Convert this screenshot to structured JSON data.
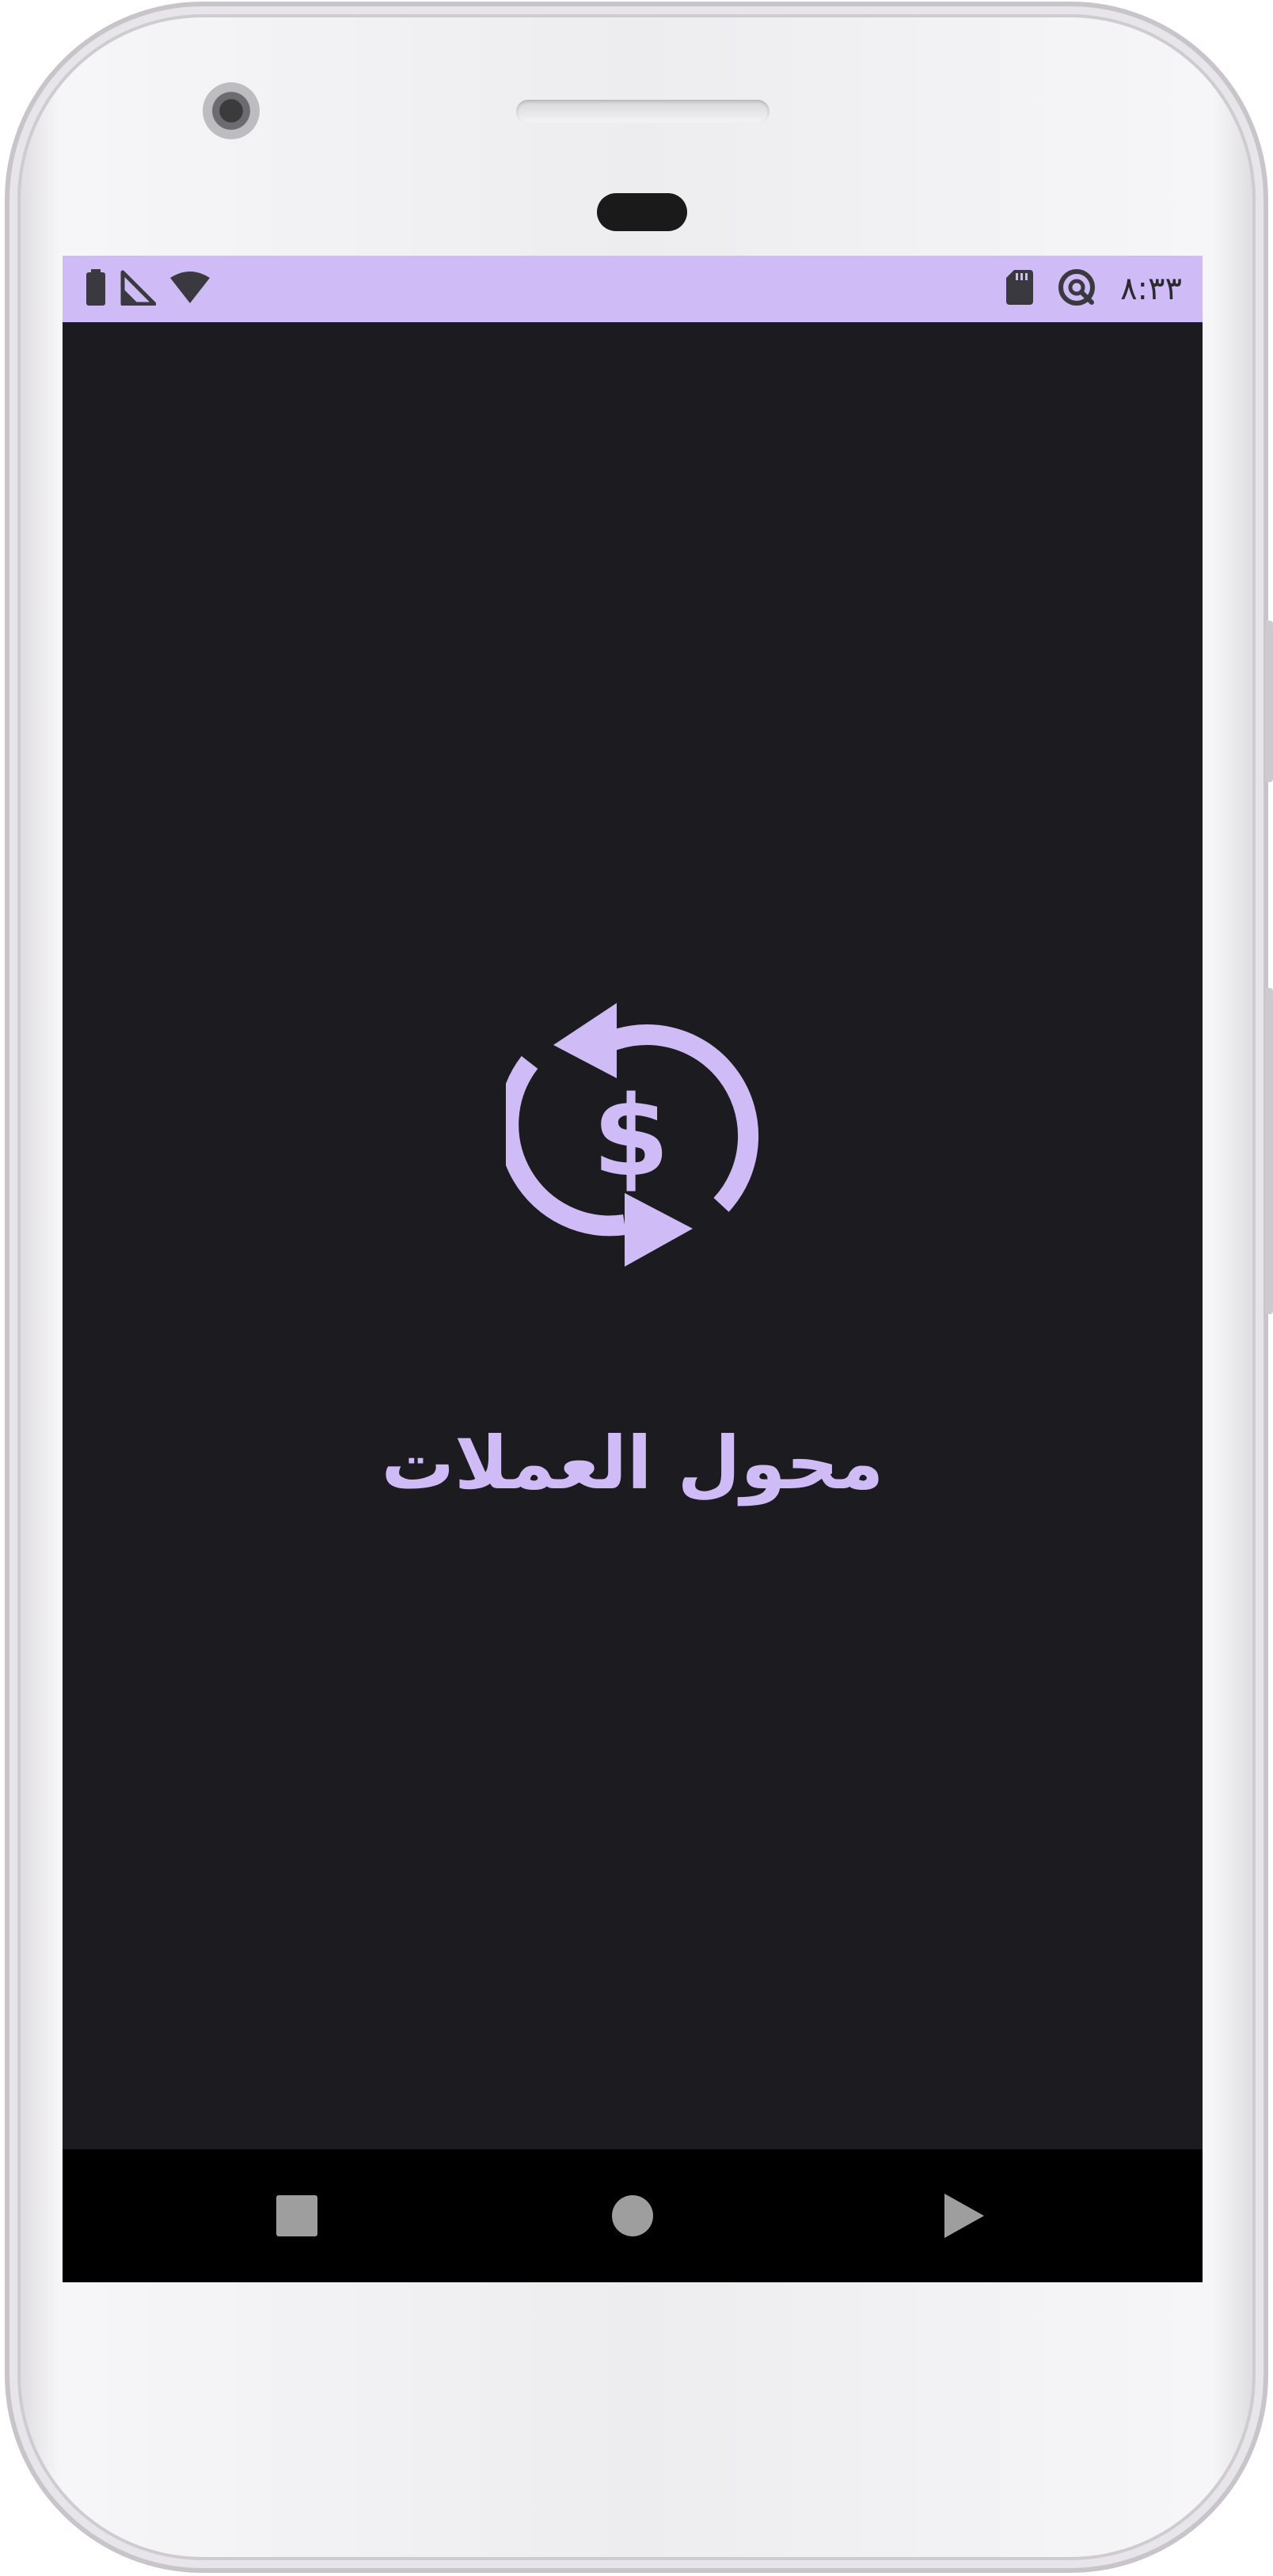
{
  "status_bar": {
    "time": "٨:٣٣",
    "icons": [
      "battery-icon",
      "signal-icon",
      "wifi-icon",
      "sd-card-icon",
      "data-saver-icon"
    ]
  },
  "app": {
    "title": "محول العملات",
    "logo_icon": "currency-exchange-icon",
    "accent_color": "#cfbcf7",
    "background_color": "#1c1b1f"
  },
  "navigation": {
    "buttons": [
      "recents-button",
      "home-button",
      "back-button"
    ]
  }
}
